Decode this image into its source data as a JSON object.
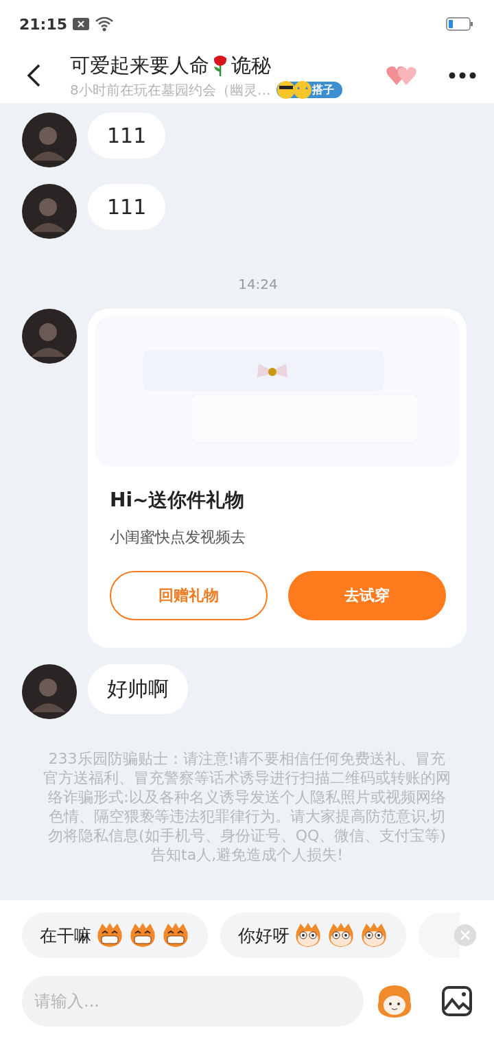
{
  "status_bar": {
    "time": "21:15"
  },
  "header": {
    "title_parts": [
      "可爱起来要人命",
      "诡秘"
    ],
    "subtitle": "8小时前在玩在墓园约会（幽灵…",
    "badge": "搭子"
  },
  "messages": [
    {
      "kind": "text",
      "text": "111"
    },
    {
      "kind": "text",
      "text": "111"
    },
    {
      "kind": "time",
      "text": "14:24"
    },
    {
      "kind": "gift",
      "title": "Hi~送你件礼物",
      "text": "小闺蜜快点发视频去",
      "buttons": [
        "回赠礼物",
        "去试穿"
      ]
    },
    {
      "kind": "text",
      "text": "好帅啊"
    }
  ],
  "tip": "233乐园防骗贴士：请注意!请不要相信任何免费送礼、冒充官方送福利、冒充警察等话术诱导进行扫描二维码或转账的网络诈骗形式:以及各种名义诱导发送个人隐私照片或视频网络色情、隔空猥亵等违法犯罪律行为。请大家提高防范意识,切勿将隐私信息(如手机号、身份证号、QQ、微信、支付宝等)告知ta人,避免造成个人损失!",
  "quick_replies": [
    {
      "text": "在干嘛",
      "kind": "grin"
    },
    {
      "text": "你好呀",
      "kind": "stare"
    }
  ],
  "input": {
    "placeholder": "请输入..."
  }
}
